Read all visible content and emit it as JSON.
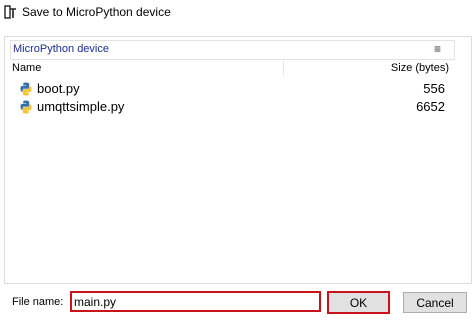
{
  "window": {
    "title": "Save to MicroPython device"
  },
  "location": {
    "path": "MicroPython device",
    "menu_icon": "hamburger-menu-icon"
  },
  "table": {
    "columns": [
      "Name",
      "Size (bytes)"
    ],
    "rows": [
      {
        "icon": "python-file-icon",
        "name": "boot.py",
        "size": "556"
      },
      {
        "icon": "python-file-icon",
        "name": "umqttsimple.py",
        "size": "6652"
      }
    ]
  },
  "footer": {
    "file_name_label": "File name:",
    "file_name_value": "main.py",
    "ok_label": "OK",
    "cancel_label": "Cancel"
  },
  "colors": {
    "highlight": "#c8131b",
    "location_text": "#1b2f8a"
  }
}
